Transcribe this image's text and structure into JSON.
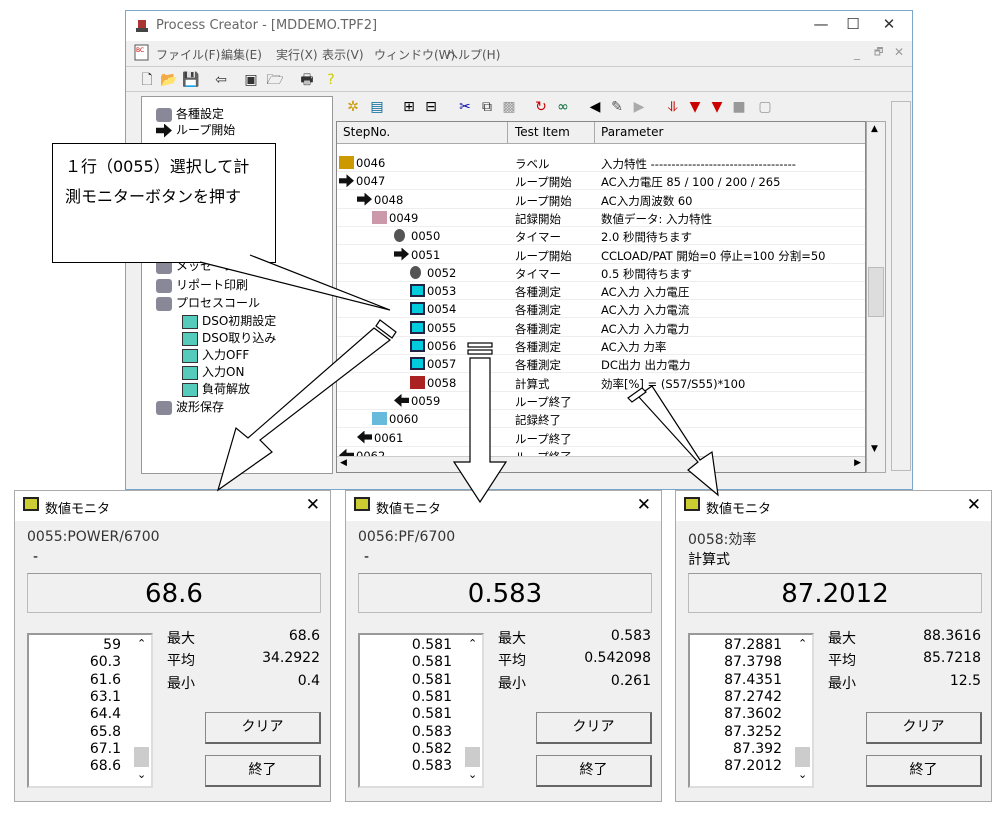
{
  "window": {
    "title": "Process Creator - [MDDEMO.TPF2]",
    "minimize": "—",
    "maximize": "☐",
    "close": "✕",
    "child_min": "_",
    "child_restore": "🗗",
    "child_close": "✕"
  },
  "menu": [
    "ファイル(F)",
    "編集(E)",
    "実行(X)",
    "表示(V)",
    "ウィンドウ(W)",
    "ヘルプ(H)"
  ],
  "toolbar1": [
    "new-file",
    "open-folder",
    "save",
    "send",
    "monitor",
    "load",
    "print",
    "help"
  ],
  "toolbar2": [
    "flow",
    "folder",
    "expand",
    "collapse",
    "cut",
    "copy",
    "paste",
    "skip",
    "watch",
    "back",
    "pointer",
    "forward",
    "step-down",
    "run-down",
    "run",
    "stop",
    "window"
  ],
  "tree": [
    {
      "label": "各種設定",
      "icon": "settings",
      "level": 0
    },
    {
      "label": "ループ開始",
      "icon": "loop-arrow",
      "level": 0
    },
    {
      "label": "メッセージ",
      "icon": "info",
      "level": 0
    },
    {
      "label": "リポート印刷",
      "icon": "report",
      "level": 0
    },
    {
      "label": "プロセスコール",
      "icon": "process",
      "level": 0,
      "expanded": true
    },
    {
      "label": "DSO初期設定",
      "icon": "sub",
      "level": 1
    },
    {
      "label": "DSO取り込み",
      "icon": "sub",
      "level": 1
    },
    {
      "label": "入力OFF",
      "icon": "sub",
      "level": 1
    },
    {
      "label": "入力ON",
      "icon": "sub",
      "level": 1
    },
    {
      "label": "負荷解放",
      "icon": "sub",
      "level": 1
    },
    {
      "label": "波形保存",
      "icon": "wave",
      "level": 0
    }
  ],
  "grid": {
    "headers": [
      "StepNo.",
      "Test Item",
      "Parameter"
    ],
    "rows": [
      {
        "step": "0046",
        "item": "ラベル",
        "param": "入力特性 -----------------------------------",
        "icon": "label",
        "indent": 0
      },
      {
        "step": "0047",
        "item": "ループ開始",
        "param": "AC入力電圧 85 / 100 / 200 / 265",
        "icon": "loop",
        "indent": 0
      },
      {
        "step": "0048",
        "item": "ループ開始",
        "param": "AC入力周波数 60",
        "icon": "loop",
        "indent": 1
      },
      {
        "step": "0049",
        "item": "記録開始",
        "param": "数値データ: 入力特性",
        "icon": "record",
        "indent": 2
      },
      {
        "step": "0050",
        "item": "タイマー",
        "param": "2.0 秒間待ちます",
        "icon": "timer",
        "indent": 3
      },
      {
        "step": "0051",
        "item": "ループ開始",
        "param": " CCLOAD/PAT 開始=0 停止=100 分割=50",
        "icon": "loop",
        "indent": 3
      },
      {
        "step": "0052",
        "item": "タイマー",
        "param": "0.5 秒間待ちます",
        "icon": "timer",
        "indent": 4
      },
      {
        "step": "0053",
        "item": "各種測定",
        "param": "AC入力 入力電圧",
        "icon": "measure",
        "indent": 4
      },
      {
        "step": "0054",
        "item": "各種測定",
        "param": "AC入力 入力電流",
        "icon": "measure",
        "indent": 4
      },
      {
        "step": "0055",
        "item": "各種測定",
        "param": "AC入力 入力電力",
        "icon": "measure",
        "indent": 4
      },
      {
        "step": "0056",
        "item": "各種測定",
        "param": "AC入力 力率",
        "icon": "measure",
        "indent": 4
      },
      {
        "step": "0057",
        "item": "各種測定",
        "param": "DC出力 出力電力",
        "icon": "measure",
        "indent": 4
      },
      {
        "step": "0058",
        "item": "計算式",
        "param": "効率[%] = (S57/S55)*100",
        "icon": "calc",
        "indent": 4
      },
      {
        "step": "0059",
        "item": "ループ終了",
        "param": "",
        "icon": "loop-end",
        "indent": 3
      },
      {
        "step": "0060",
        "item": "記録終了",
        "param": "",
        "icon": "record-end",
        "indent": 2
      },
      {
        "step": "0061",
        "item": "ループ終了",
        "param": "",
        "icon": "loop-end",
        "indent": 1
      },
      {
        "step": "0062",
        "item": "ループ終了",
        "param": "",
        "icon": "loop-end",
        "indent": 0
      }
    ]
  },
  "callout": {
    "text": "１行（0055）選択して計測モニターボタンを押す"
  },
  "monitors": [
    {
      "title": "数値モニタ",
      "label": "0055:POWER/6700",
      "sub": "-",
      "value": "68.6",
      "list": [
        "59",
        "60.3",
        "61.6",
        "63.1",
        "64.4",
        "65.8",
        "67.1",
        "68.6"
      ],
      "max_label": "最大",
      "max": "68.6",
      "avg_label": "平均",
      "avg": "34.2922",
      "min_label": "最小",
      "min": "0.4",
      "clear": "クリア",
      "exit": "終了"
    },
    {
      "title": "数値モニタ",
      "label": "0056:PF/6700",
      "sub": "-",
      "value": "0.583",
      "list": [
        "0.581",
        "0.581",
        "0.581",
        "0.581",
        "0.581",
        "0.583",
        "0.582",
        "0.583"
      ],
      "max_label": "最大",
      "max": "0.583",
      "avg_label": "平均",
      "avg": "0.542098",
      "min_label": "最小",
      "min": "0.261",
      "clear": "クリア",
      "exit": "終了"
    },
    {
      "title": "数値モニタ",
      "label": "0058:効率",
      "sub": "計算式",
      "value": "87.2012",
      "list": [
        "87.2881",
        "87.3798",
        "87.4351",
        "87.2742",
        "87.3602",
        "87.3252",
        "87.392",
        "87.2012"
      ],
      "max_label": "最大",
      "max": "88.3616",
      "avg_label": "平均",
      "avg": "85.7218",
      "min_label": "最小",
      "min": "12.5",
      "clear": "クリア",
      "exit": "終了"
    }
  ]
}
